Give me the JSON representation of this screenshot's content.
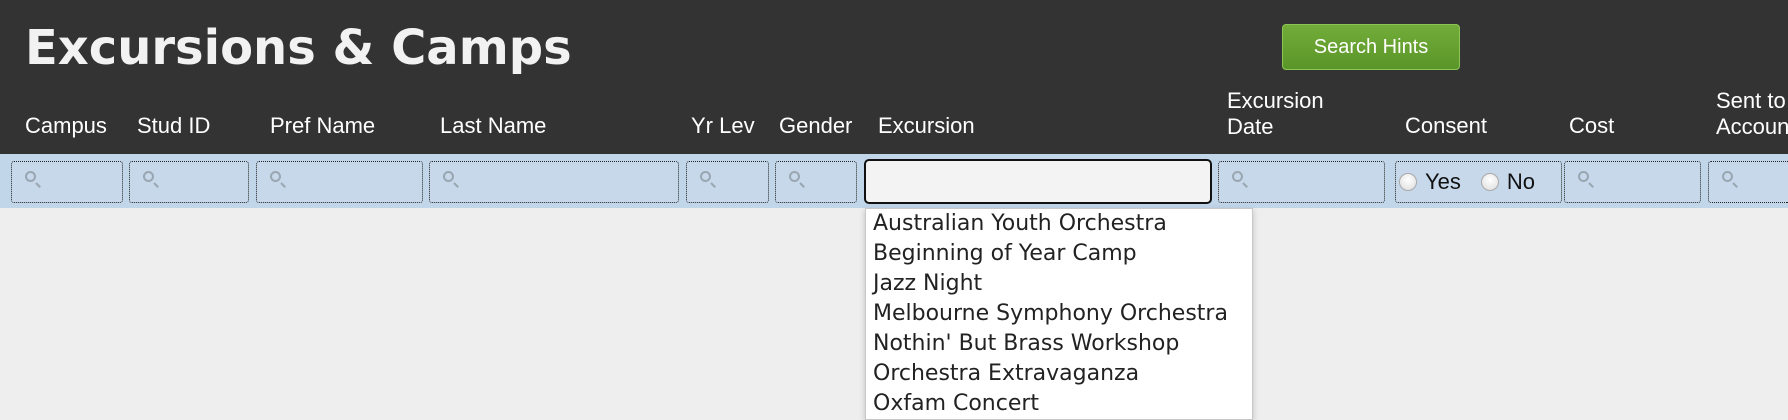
{
  "page": {
    "title": "Excursions & Camps"
  },
  "toolbar": {
    "search_hints_label": "Search Hints"
  },
  "columns": {
    "campus": "Campus",
    "stud_id": "Stud ID",
    "pref_name": "Pref Name",
    "last_name": "Last Name",
    "yr_lev": "Yr Lev",
    "gender": "Gender",
    "excursion": "Excursion",
    "excursion_date_line1": "Excursion",
    "excursion_date_line2": "Date",
    "consent": "Consent",
    "cost": "Cost",
    "sent_line1": "Sent to",
    "sent_line2": "Accounts"
  },
  "filters": {
    "excursion_value": "",
    "consent_yes": "Yes",
    "consent_no": "No"
  },
  "dropdown": {
    "options": [
      "Australian Youth Orchestra",
      "Beginning of Year Camp",
      "Jazz Night",
      "Melbourne Symphony Orchestra",
      "Nothin' But Brass Workshop",
      "Orchestra Extravaganza",
      "Oxfam Concert"
    ]
  },
  "colors": {
    "header_bg": "#333333",
    "filter_bg": "#c2d6ea",
    "button_green": "#5a9528",
    "page_bg": "#eeeeee"
  },
  "icons": {
    "filter_icon": "search-icon"
  }
}
